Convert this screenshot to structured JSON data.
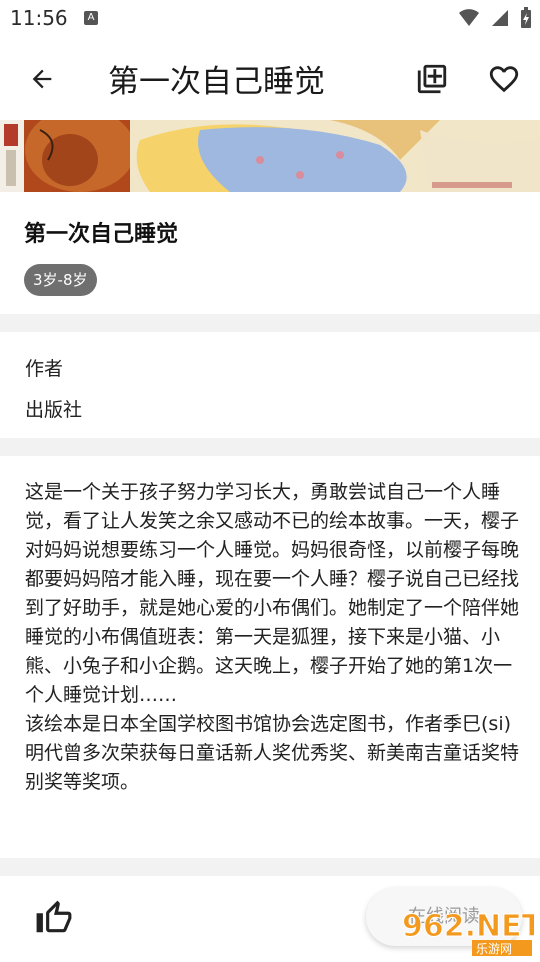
{
  "status_bar": {
    "time": "11:56",
    "notification_icon": "A"
  },
  "app_bar": {
    "title": "第一次自己睡觉",
    "back_icon": "arrow-left-icon",
    "add_icon": "library-add-icon",
    "favorite_icon": "heart-outline-icon"
  },
  "book": {
    "title": "第一次自己睡觉",
    "age_range": "3岁-8岁"
  },
  "meta": {
    "author_label": "作者",
    "publisher_label": "出版社"
  },
  "description": "这是一个关于孩子努力学习长大，勇敢尝试自己一个人睡觉，看了让人发笑之余又感动不已的绘本故事。一天，樱子对妈妈说想要练习一个人睡觉。妈妈很奇怪，以前樱子每晚都要妈妈陪才能入睡，现在要一个人睡？樱子说自己已经找到了好助手，就是她心爱的小布偶们。她制定了一个陪伴她睡觉的小布偶值班表：第一天是狐狸，接下来是小猫、小熊、小兔子和小企鹅。这天晚上，樱子开始了她的第1次一个人睡觉计划……\n该绘本是日本全国学校图书馆协会选定图书，作者季巳(si)明代曾多次荣获每日童话新人奖优秀奖、新美南吉童话奖特别奖等奖项。",
  "bottom_bar": {
    "like_icon": "thumbs-up-icon",
    "read_button_label": "在线阅读"
  },
  "watermark": {
    "brand": "962.NET",
    "sub": "乐游网"
  },
  "colors": {
    "chip_bg": "#6f6f6f",
    "divider": "#f2f2f2",
    "watermark_orange": "#f39a1e"
  }
}
